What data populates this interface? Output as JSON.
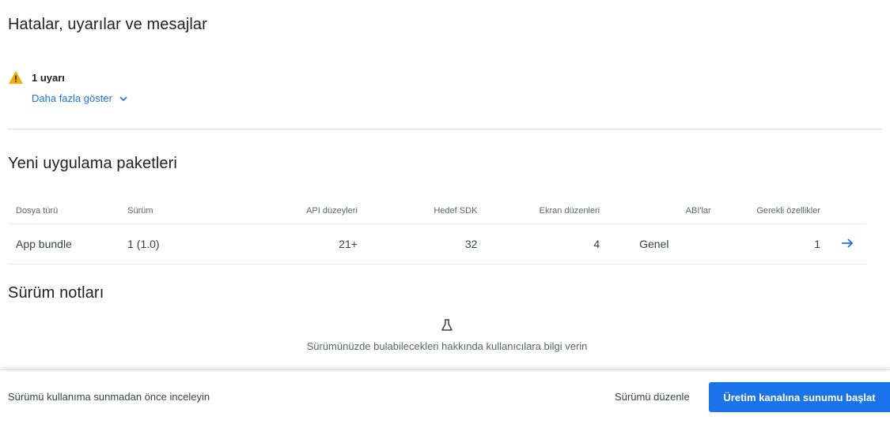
{
  "errors_section": {
    "title": "Hatalar, uyarılar ve mesajlar",
    "warning_count": "1 uyarı",
    "show_more": "Daha fazla göster"
  },
  "bundles_section": {
    "title": "Yeni uygulama paketleri",
    "columns": {
      "file_type": "Dosya türü",
      "version": "Sürüm",
      "api_levels": "API düzeyleri",
      "target_sdk": "Hedef SDK",
      "screen_layouts": "Ekran düzenleri",
      "abis": "ABI'lar",
      "required_features": "Gerekli özellikler"
    },
    "rows": [
      {
        "file_type": "App bundle",
        "version": "1 (1.0)",
        "api_levels": "21+",
        "target_sdk": "32",
        "screen_layouts": "4",
        "abis": "Genel",
        "required_features": "1"
      }
    ]
  },
  "release_notes": {
    "title": "Sürüm notları",
    "empty_text": "Sürümünüzde bulabilecekleri hakkında kullanıcılara bilgi verin"
  },
  "footer": {
    "review_text": "Sürümü kullanıma sunmadan önce inceleyin",
    "edit_label": "Sürümü düzenle",
    "start_rollout_label": "Üretim kanalına sunumu başlat"
  },
  "colors": {
    "accent": "#1a73e8",
    "warning": "#f9ab00",
    "divider": "#dadce0"
  },
  "icons": {
    "warning": "warning-triangle-icon",
    "chevron": "chevron-down-icon",
    "arrow": "arrow-right-icon",
    "empty_state": "flask-icon"
  }
}
